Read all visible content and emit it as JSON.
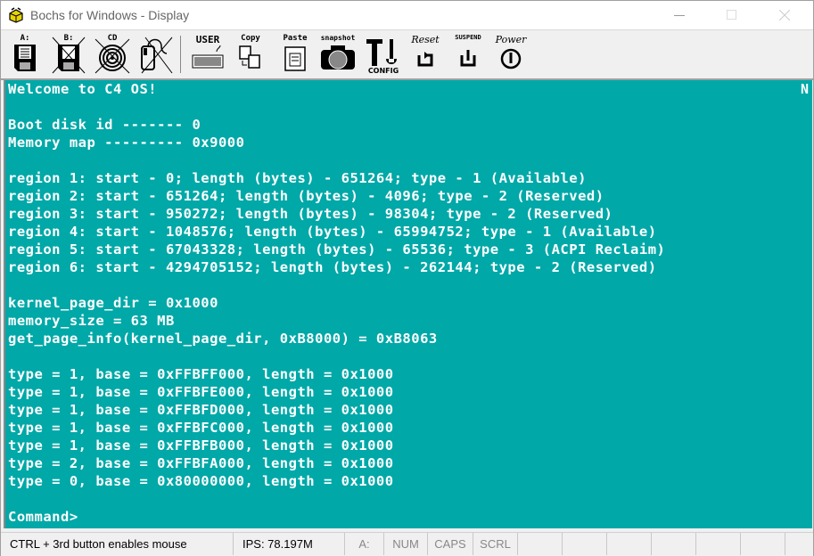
{
  "window": {
    "title": "Bochs for Windows - Display",
    "controls": [
      "minimize",
      "maximize",
      "close"
    ]
  },
  "toolbar": {
    "items": [
      {
        "id": "floppy-a",
        "label": "A:",
        "icon": "floppy-disk-icon"
      },
      {
        "id": "floppy-b",
        "label": "B:",
        "icon": "floppy-disk-disabled-icon"
      },
      {
        "id": "cdrom",
        "label": "CD",
        "icon": "cdrom-disabled-icon"
      },
      {
        "id": "mouse",
        "label": "",
        "icon": "mouse-disabled-icon"
      },
      {
        "id": "user",
        "label": "USER",
        "icon": "keyboard-icon"
      },
      {
        "id": "copy",
        "label": "Copy",
        "icon": "copy-icon"
      },
      {
        "id": "paste",
        "label": "Paste",
        "icon": "paste-icon"
      },
      {
        "id": "snapshot",
        "label": "snapshot",
        "icon": "camera-icon"
      },
      {
        "id": "config",
        "label": "CONFIG",
        "icon": "config-tools-icon"
      },
      {
        "id": "reset",
        "label": "Reset",
        "icon": "reset-icon"
      },
      {
        "id": "suspend",
        "label": "SUSPEND",
        "icon": "suspend-icon"
      },
      {
        "id": "power",
        "label": "Power",
        "icon": "power-icon"
      }
    ]
  },
  "console": {
    "corner_indicator": "N",
    "lines": [
      "Welcome to C4 OS!",
      "",
      "Boot disk id ------- 0",
      "Memory map --------- 0x9000",
      "",
      "region 1: start - 0; length (bytes) - 651264; type - 1 (Available)",
      "region 2: start - 651264; length (bytes) - 4096; type - 2 (Reserved)",
      "region 3: start - 950272; length (bytes) - 98304; type - 2 (Reserved)",
      "region 4: start - 1048576; length (bytes) - 65994752; type - 1 (Available)",
      "region 5: start - 67043328; length (bytes) - 65536; type - 3 (ACPI Reclaim)",
      "region 6: start - 4294705152; length (bytes) - 262144; type - 2 (Reserved)",
      "",
      "kernel_page_dir = 0x1000",
      "memory_size = 63 MB",
      "get_page_info(kernel_page_dir, 0xB8000) = 0xB8063",
      "",
      "type = 1, base = 0xFFBFF000, length = 0x1000",
      "type = 1, base = 0xFFBFE000, length = 0x1000",
      "type = 1, base = 0xFFBFD000, length = 0x1000",
      "type = 1, base = 0xFFBFC000, length = 0x1000",
      "type = 1, base = 0xFFBFB000, length = 0x1000",
      "type = 2, base = 0xFFBFA000, length = 0x1000",
      "type = 0, base = 0x80000000, length = 0x1000",
      "",
      "Command>"
    ]
  },
  "statusbar": {
    "message": "CTRL + 3rd button enables mouse",
    "ips": "IPS: 78.197M",
    "drive": "A:",
    "num": "NUM",
    "caps": "CAPS",
    "scrl": "SCRL"
  },
  "colors": {
    "screen_bg": "#00a8a8",
    "screen_fg": "#ffffff"
  }
}
